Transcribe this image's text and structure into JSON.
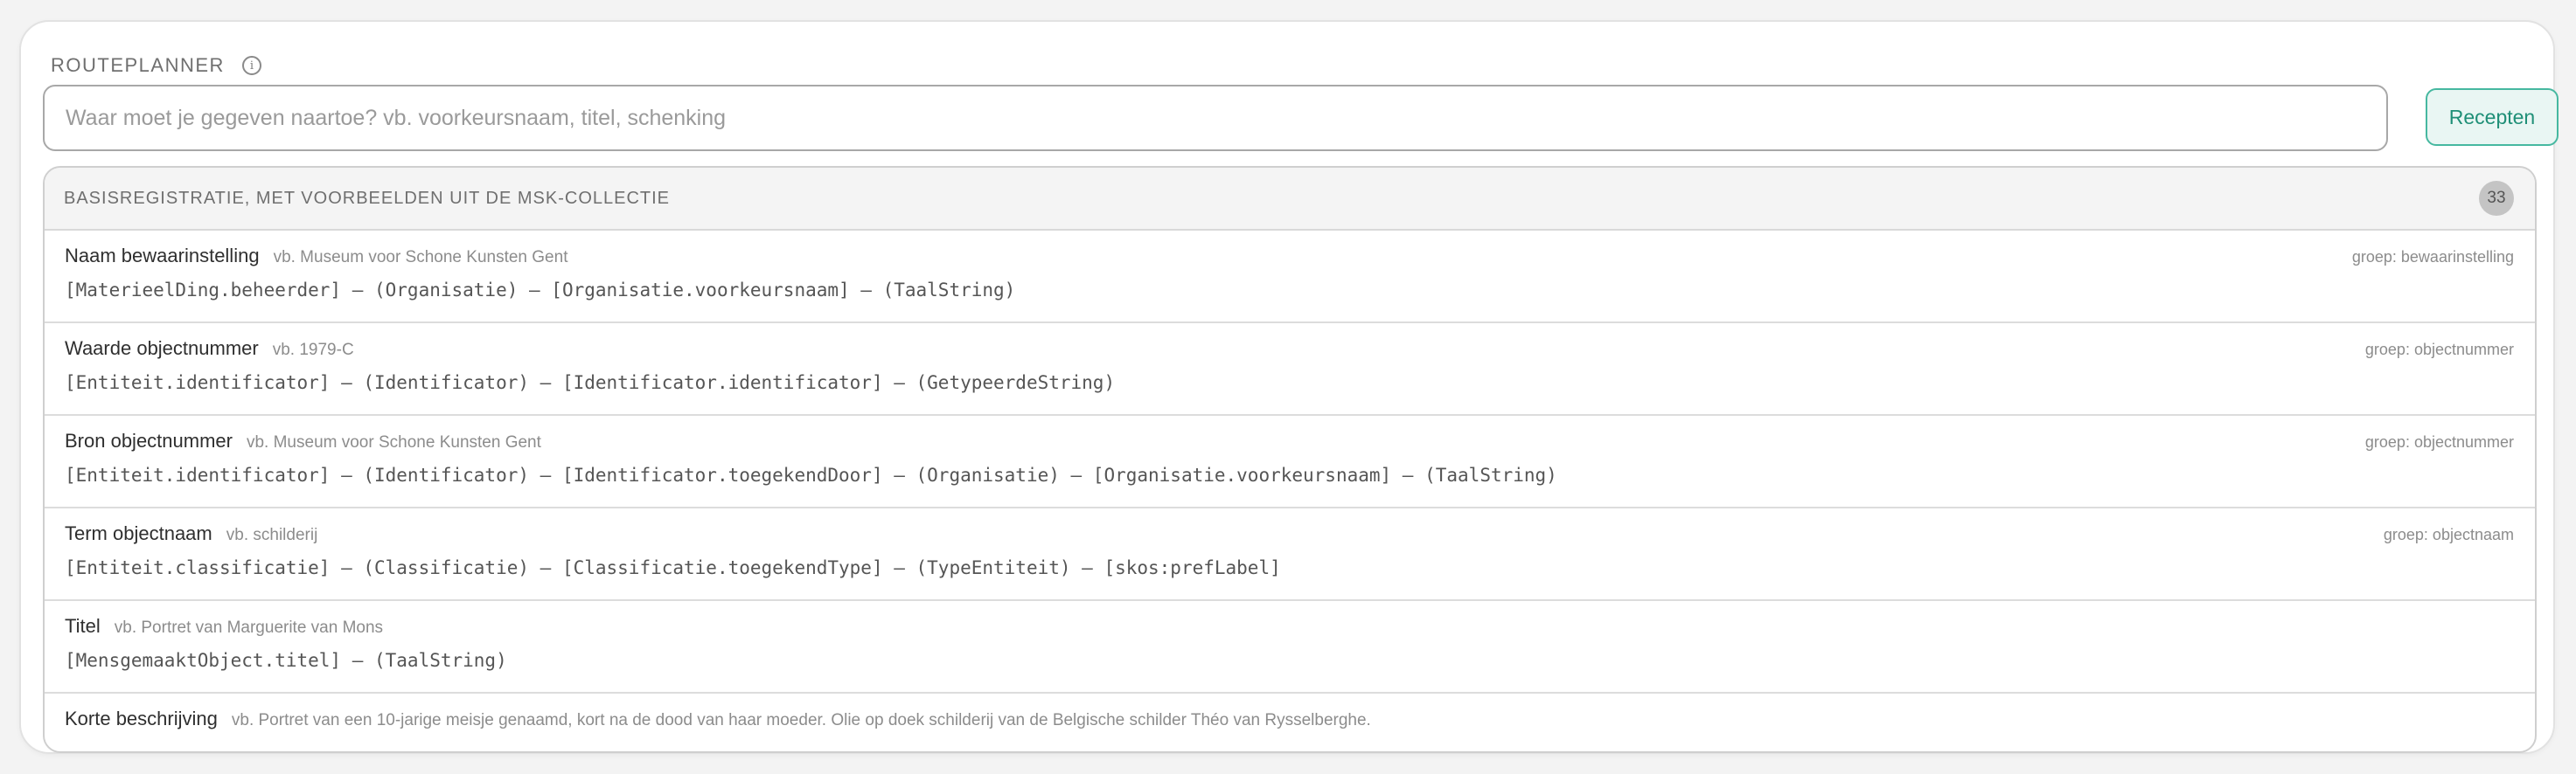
{
  "header": {
    "title": "ROUTEPLANNER",
    "info_icon": "info-icon"
  },
  "search": {
    "placeholder": "Waar moet je gegeven naartoe? vb. voorkeursnaam, titel, schenking",
    "value": ""
  },
  "recepten_button": {
    "label": "Recepten"
  },
  "panel": {
    "title": "BASISREGISTRATIE, MET VOORBEELDEN UIT DE MSK-COLLECTIE",
    "count": "33"
  },
  "rows": [
    {
      "title": "Naam bewaarinstelling",
      "example": "vb. Museum voor Schone Kunsten Gent",
      "group": "groep: bewaarinstelling",
      "path": "[MaterieelDing.beheerder] – (Organisatie) – [Organisatie.voorkeursnaam] – (TaalString)"
    },
    {
      "title": "Waarde objectnummer",
      "example": "vb. 1979-C",
      "group": "groep: objectnummer",
      "path": "[Entiteit.identificator] – (Identificator) – [Identificator.identificator] – (GetypeerdeString)"
    },
    {
      "title": "Bron objectnummer",
      "example": "vb. Museum voor Schone Kunsten Gent",
      "group": "groep: objectnummer",
      "path": "[Entiteit.identificator] – (Identificator) – [Identificator.toegekendDoor] – (Organisatie) – [Organisatie.voorkeursnaam] – (TaalString)"
    },
    {
      "title": "Term objectnaam",
      "example": "vb. schilderij",
      "group": "groep: objectnaam",
      "path": "[Entiteit.classificatie] – (Classificatie) – [Classificatie.toegekendType] – (TypeEntiteit) – [skos:prefLabel]"
    },
    {
      "title": "Titel",
      "example": "vb. Portret van Marguerite van Mons",
      "group": "",
      "path": "[MensgemaaktObject.titel] – (TaalString)"
    },
    {
      "title": "Korte beschrijving",
      "example": "vb. Portret van een 10-jarige meisje genaamd, kort na de dood van haar moeder. Olie op doek schilderij van de Belgische schilder Théo van Rysselberghe.",
      "group": "",
      "path": ""
    }
  ],
  "colors": {
    "accent": "#46b8a0",
    "accent_bg": "#e9f6f3",
    "accent_text": "#1f8f77",
    "badge_bg": "#c4c4c4"
  }
}
